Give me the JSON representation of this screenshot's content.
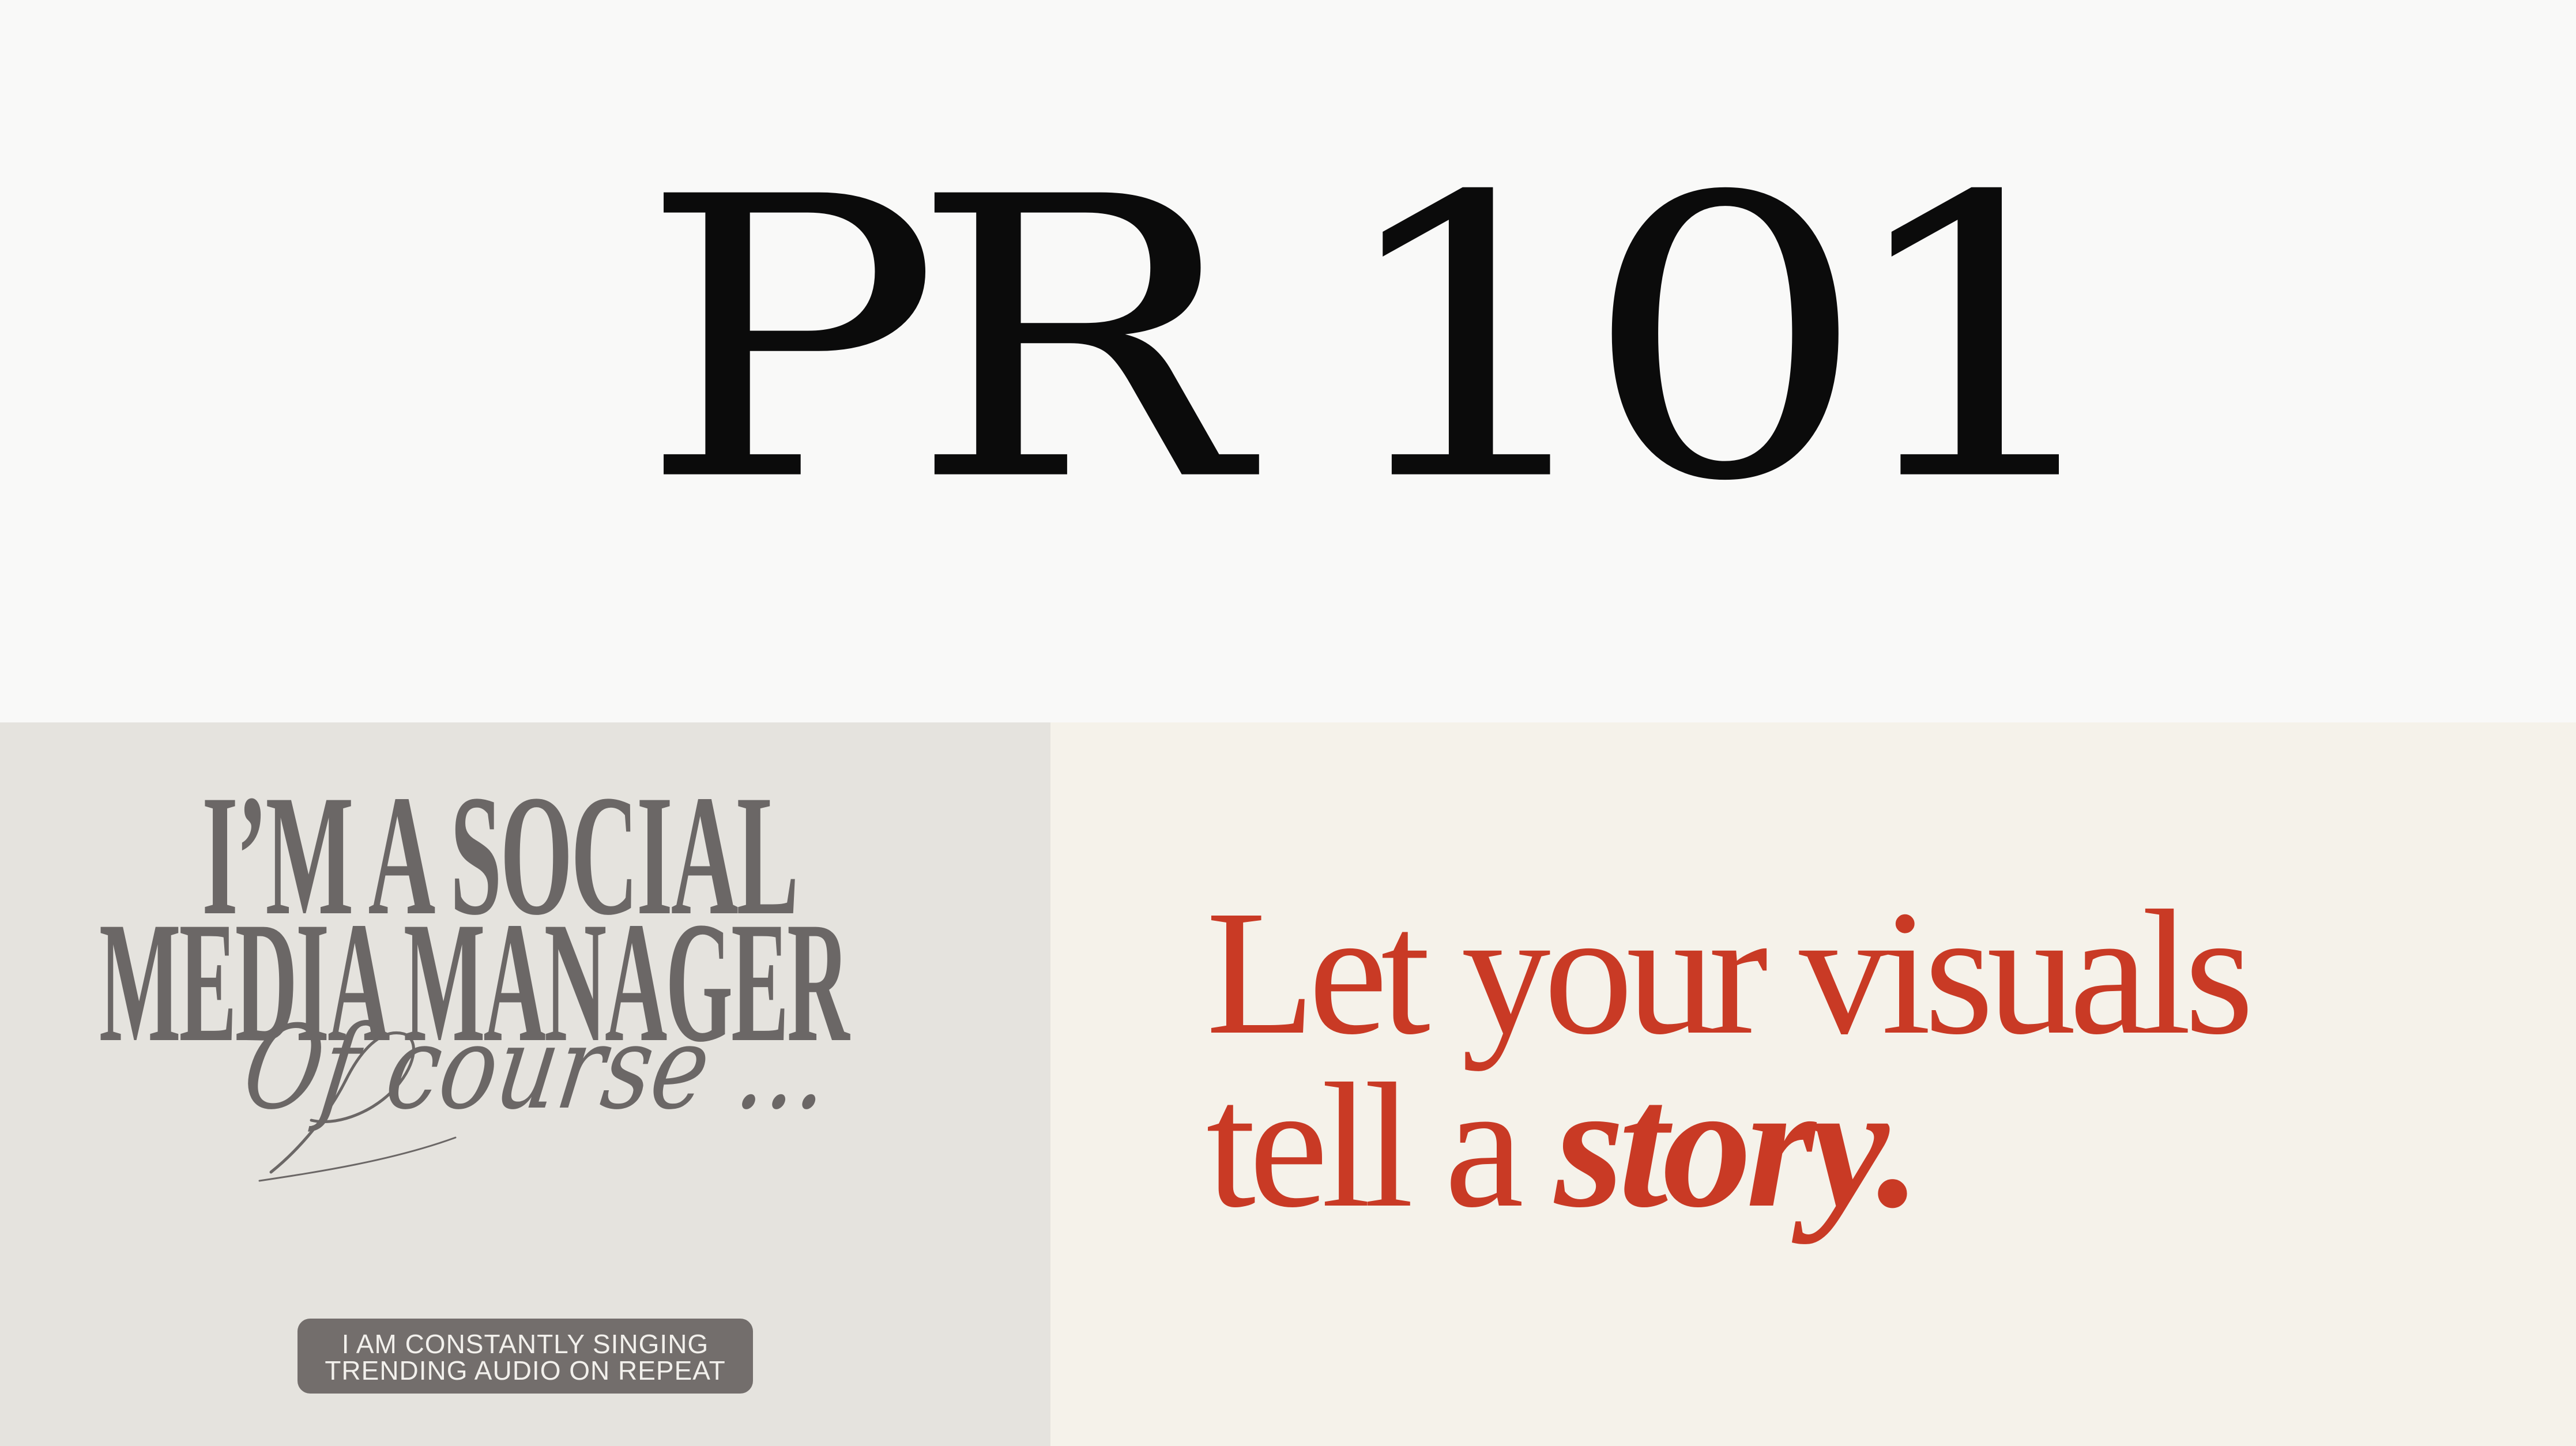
{
  "top": {
    "title": "PR 101"
  },
  "social_card": {
    "line1": "I’M A SOCIAL",
    "line2": "MEDIA MANAGER",
    "script": "Of course ...",
    "pill_line1": "I AM  CONSTANTLY SINGING",
    "pill_line2": "TRENDING AUDIO ON REPEAT"
  },
  "story_card": {
    "line1": "Let your visuals",
    "line2_prefix": "tell a ",
    "line2_emphasis": "story."
  },
  "colors": {
    "top_bg": "#f9f9f8",
    "title_text": "#0b0b0b",
    "social_bg": "#e5e3de",
    "social_text": "#6b6766",
    "pill_bg": "#736e6c",
    "pill_text": "#f2f0ec",
    "story_bg": "#f5f2ea",
    "story_text": "#c93a25"
  }
}
